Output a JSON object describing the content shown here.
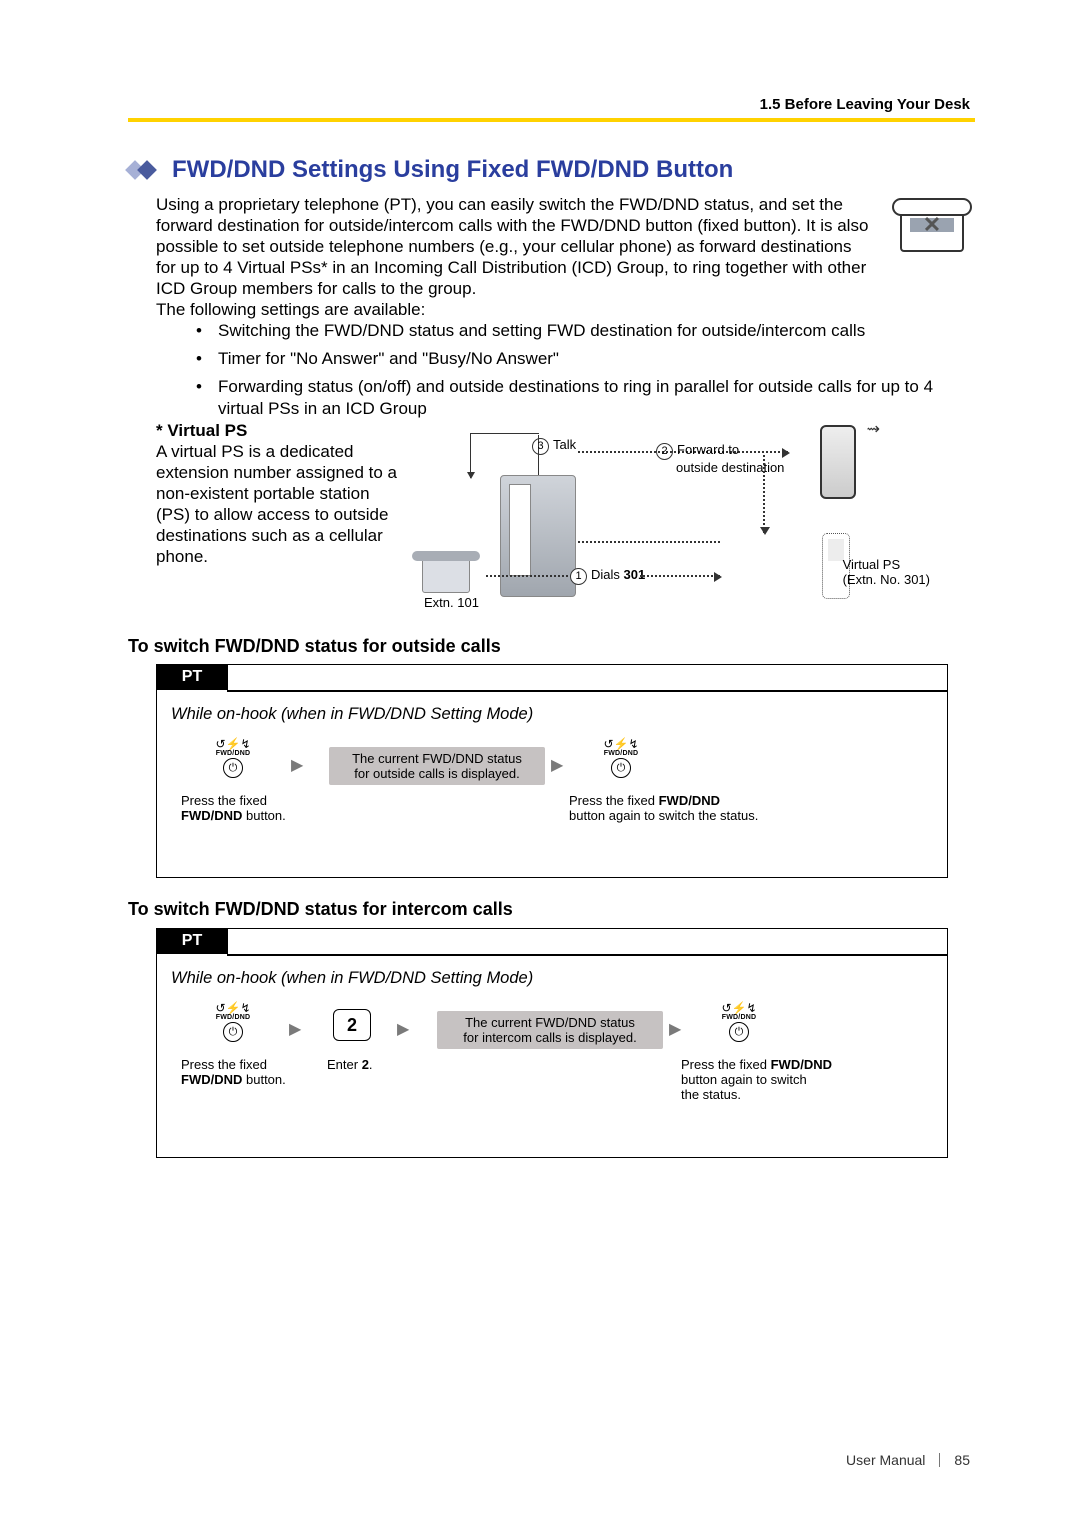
{
  "header": {
    "section": "1.5 Before Leaving Your Desk"
  },
  "title": "FWD/DND Settings Using Fixed FWD/DND Button",
  "intro": "Using a proprietary telephone (PT), you can easily switch the FWD/DND status, and set the forward destination for outside/intercom calls with the FWD/DND button (fixed button). It is also possible to set outside telephone numbers (e.g., your cellular phone) as forward destinations for up to 4 Virtual PSs* in an Incoming Call Distribution (ICD) Group, to ring together with other ICD Group members for calls to the group.\nThe following settings are available:",
  "bullets": [
    "Switching the FWD/DND status and setting FWD destination for outside/intercom calls",
    "Timer for \"No Answer\" and \"Busy/No Answer\"",
    "Forwarding status (on/off) and outside destinations to ring in parallel for outside calls for up to 4 virtual PSs in an ICD Group"
  ],
  "virtual_ps": {
    "heading": "* Virtual PS",
    "text": "A virtual PS is a dedicated extension number assigned to a non-existent portable station (PS) to allow access to outside destinations such as a cellular phone."
  },
  "diagram": {
    "talk_num": "3",
    "talk": "Talk",
    "fwd_num": "2",
    "fwd_line1": "Forward to",
    "fwd_line2": "outside destination",
    "dials_num": "1",
    "dials_text": "Dials ",
    "dials_bold": "301",
    "extn": "Extn. 101",
    "vps_l1": "Virtual PS",
    "vps_l2": "(Extn. No. 301)"
  },
  "sections": {
    "outside_heading": "To switch FWD/DND status for outside calls",
    "intercom_heading": "To switch FWD/DND status for intercom calls"
  },
  "procedure": {
    "pt": "PT",
    "mode_note": "While on-hook (when in FWD/DND Setting Mode)",
    "fwd_icon_sym": "↺⚡↯",
    "fwd_icon_label": "FWD/DND",
    "btn_glyph": "⏻",
    "arrow": "▶",
    "desc_outside": "The current FWD/DND status\nfor outside calls is displayed.",
    "desc_intercom": "The current FWD/DND status\nfor intercom calls is displayed.",
    "cap_press_pre": "Press the fixed",
    "cap_press_bold": "FWD/DND",
    "cap_press_post": " button.",
    "key2": "2",
    "cap_enter_pre": "Enter ",
    "cap_enter_bold": "2",
    "cap_enter_post": ".",
    "cap_again_pre": "Press the fixed ",
    "cap_again_bold": "FWD/DND",
    "cap_again_outside_post": "\nbutton again to switch the status.",
    "cap_again_intercom_post": "\nbutton again to switch\nthe status."
  },
  "footer": {
    "label": "User Manual",
    "page": "85"
  }
}
